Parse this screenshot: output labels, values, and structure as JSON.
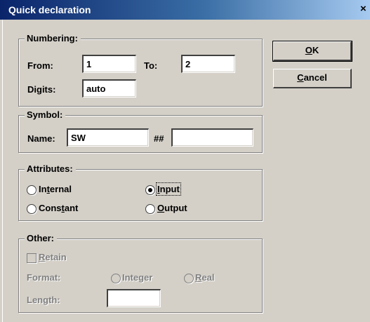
{
  "window": {
    "title": "Quick declaration",
    "close_glyph": "×"
  },
  "numbering": {
    "legend": "Numbering:",
    "from_label": "From:",
    "from_value": "1",
    "to_label": "To:",
    "to_value": "2",
    "digits_label": "Digits:",
    "digits_value": "auto"
  },
  "symbol": {
    "legend": "Symbol:",
    "name_label": "Name:",
    "name_value": "SW",
    "hash_label": "##",
    "hash_value": ""
  },
  "attributes": {
    "legend": "Attributes:",
    "internal": {
      "pre": "In",
      "key": "t",
      "post": "ernal"
    },
    "constant": {
      "pre": "Cons",
      "key": "t",
      "post": "ant"
    },
    "input": {
      "pre": "",
      "key": "I",
      "post": "nput"
    },
    "output": {
      "pre": "",
      "key": "O",
      "post": "utput"
    },
    "selected": "Input"
  },
  "other": {
    "legend": "Other:",
    "retain": {
      "pre": "",
      "key": "R",
      "post": "etain"
    },
    "format_label": "Format:",
    "integer_label": "Integer",
    "real": {
      "pre": "",
      "key": "R",
      "post": "eal"
    },
    "length_label": "Length:",
    "length_value": ""
  },
  "buttons": {
    "ok": {
      "pre": "",
      "key": "O",
      "post": "K"
    },
    "cancel": {
      "pre": "",
      "key": "C",
      "post": "ancel"
    }
  },
  "colors": {
    "face": "#d4d0c8",
    "title_start": "#0a246a",
    "title_end": "#a6caf0",
    "disabled_text": "#808080"
  }
}
